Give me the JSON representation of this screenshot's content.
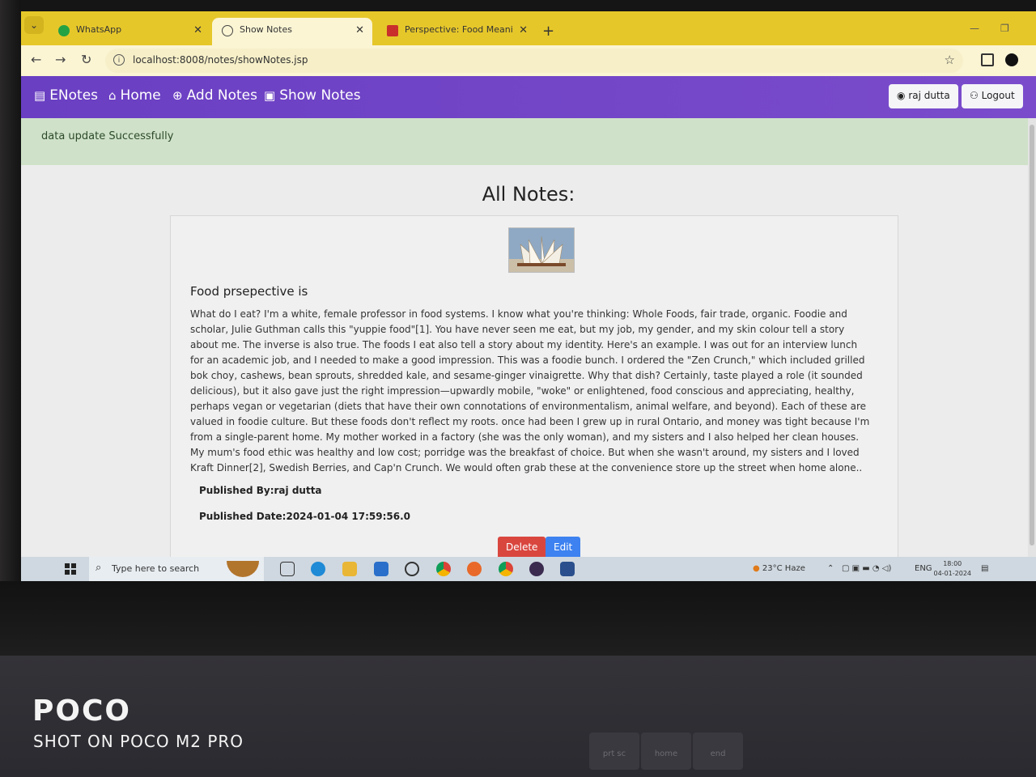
{
  "browser": {
    "tabs": [
      {
        "label": "WhatsApp",
        "active": false
      },
      {
        "label": "Show Notes",
        "active": true
      },
      {
        "label": "Perspective: Food Meanings – F",
        "active": false
      }
    ],
    "url": "localhost:8008/notes/showNotes.jsp"
  },
  "nav": {
    "brand": "ENotes",
    "links": [
      "Home",
      "Add Notes",
      "Show Notes"
    ],
    "user": "raj dutta",
    "logout": "Logout"
  },
  "alert": "data update Successfully",
  "page": {
    "heading": "All Notes:",
    "note": {
      "title": "Food prsepective is",
      "body": "What do I eat? I'm a white, female professor in food systems. I know what you're thinking: Whole Foods, fair trade, organic. Foodie and scholar, Julie Guthman calls this \"yuppie food\"[1]. You have never seen me eat, but my job, my gender, and my skin colour tell a story about me. The inverse is also true. The foods I eat also tell a story about my identity. Here's an example. I was out for an interview lunch for an academic job, and I needed to make a good impression. This was a foodie bunch. I ordered the \"Zen Crunch,\" which included grilled bok choy, cashews, bean sprouts, shredded kale, and sesame-ginger vinaigrette. Why that dish? Certainly, taste played a role (it sounded delicious), but it also gave just the right impression—upwardly mobile, \"woke\" or enlightened, food conscious and appreciating, healthy, perhaps vegan or vegetarian (diets that have their own connotations of environmentalism, animal welfare, and beyond). Each of these are valued in foodie culture. But these foods don't reflect my roots. once had been I grew up in rural Ontario, and money was tight because I'm from a single-parent home. My mother worked in a factory (she was the only woman), and my sisters and I also helped her clean houses. My mum's food ethic was healthy and low cost; porridge was the breakfast of choice. But when she wasn't around, my sisters and I loved Kraft Dinner[2], Swedish Berries, and Cap'n Crunch. We would often grab these at the convenience store up the street when home alone..",
      "published_by": "Published By:raj dutta",
      "published_date": "Published Date:2024-01-04 17:59:56.0",
      "delete_label": "Delete",
      "edit_label": "Edit"
    }
  },
  "taskbar": {
    "search_placeholder": "Type here to search",
    "weather": "23°C  Haze",
    "lang": "ENG",
    "time": "18:00",
    "date": "04-01-2024"
  },
  "watermark": {
    "brand": "POCO",
    "line": "SHOT ON POCO M2 PRO"
  },
  "keyboard_labels": [
    "prt sc",
    "home",
    "end"
  ],
  "colors": {
    "browser_frame": "#e6c72a",
    "navbar": "#7a4ccc",
    "alert_bg": "#cfe2c9",
    "delete_btn": "#d9463e",
    "edit_btn": "#3d82f0"
  }
}
